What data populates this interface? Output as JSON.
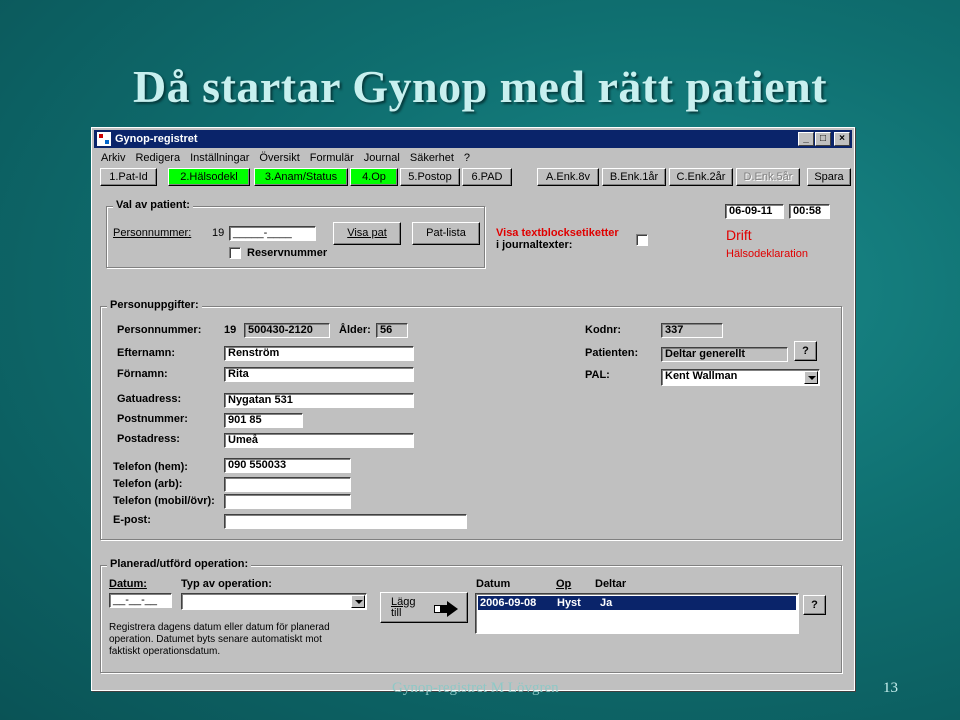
{
  "slide": {
    "title": "Då startar Gynop med rätt patient",
    "footer": "Gynop-registret M Lövgren",
    "page_number": "13"
  },
  "window": {
    "title": "Gynop-registret",
    "controls": [
      "_",
      "□",
      "×"
    ]
  },
  "menu": [
    "Arkiv",
    "Redigera",
    "Inställningar",
    "Översikt",
    "Formulär",
    "Journal",
    "Säkerhet",
    "?"
  ],
  "toolbar": {
    "buttons": [
      "1.Pat-Id",
      "2.Hälsodekl",
      "3.Anam/Status",
      "4.Op",
      "5.Postop",
      "6.PAD",
      "A.Enk.8v",
      "B.Enk.1år",
      "C.Enk.2år",
      "D.Enk.5år",
      "Spara"
    ]
  },
  "val_av_patient": {
    "title": "Val av patient:",
    "personnummer_label": "Personnummer:",
    "century": "19",
    "personnummer_value": "_____-____",
    "reservnummer_label": "Reservnummer",
    "visa_pat": "Visa pat",
    "pat_lista": "Pat-lista",
    "visa_textblock_line1": "Visa textblocksetiketter",
    "visa_textblock_line2": "i journaltexter:",
    "date": "06-09-11",
    "time": "00:58",
    "drift": "Drift",
    "halsodeklaration": "Hälsodeklaration"
  },
  "personuppgifter": {
    "title": "Personuppgifter:",
    "personnummer_label": "Personnummer:",
    "century": "19",
    "personnummer": "500430-2120",
    "alder_label": "Ålder:",
    "alder": "56",
    "kodnr_label": "Kodnr:",
    "kodnr": "337",
    "efternamn_label": "Efternamn:",
    "efternamn": "Renström",
    "patienten_label": "Patienten:",
    "patienten": "Deltar generellt",
    "help": "?",
    "fornamn_label": "Förnamn:",
    "fornamn": "Rita",
    "pal_label": "PAL:",
    "pal": "Kent Wallman",
    "gatuadress_label": "Gatuadress:",
    "gatuadress": "Nygatan 531",
    "postnummer_label": "Postnummer:",
    "postnummer": "901 85",
    "postadress_label": "Postadress:",
    "postadress": "Umeå",
    "tel_hem_label": "Telefon (hem):",
    "tel_hem": "090 550033",
    "tel_arb_label": "Telefon (arb):",
    "tel_arb": "",
    "tel_mobil_label": "Telefon (mobil/övr):",
    "tel_mobil": "",
    "epost_label": "E-post:",
    "epost": ""
  },
  "operation": {
    "title": "Planerad/utförd operation:",
    "datum_label": "Datum:",
    "typ_label": "Typ av operation:",
    "datum_value": "__-__-__",
    "typ_value": "",
    "add_button_line1": "Lägg",
    "add_button_line2": "till",
    "help_line1": "Registrera dagens datum eller datum för planerad",
    "help_line2": "operation. Datumet byts senare automatiskt mot",
    "help_line3": "faktiskt operationsdatum.",
    "list_headers": [
      "Datum",
      "Op",
      "Deltar"
    ],
    "rows": [
      {
        "datum": "2006-09-08",
        "op": "Hyst",
        "deltar": "Ja"
      }
    ],
    "help": "?"
  }
}
